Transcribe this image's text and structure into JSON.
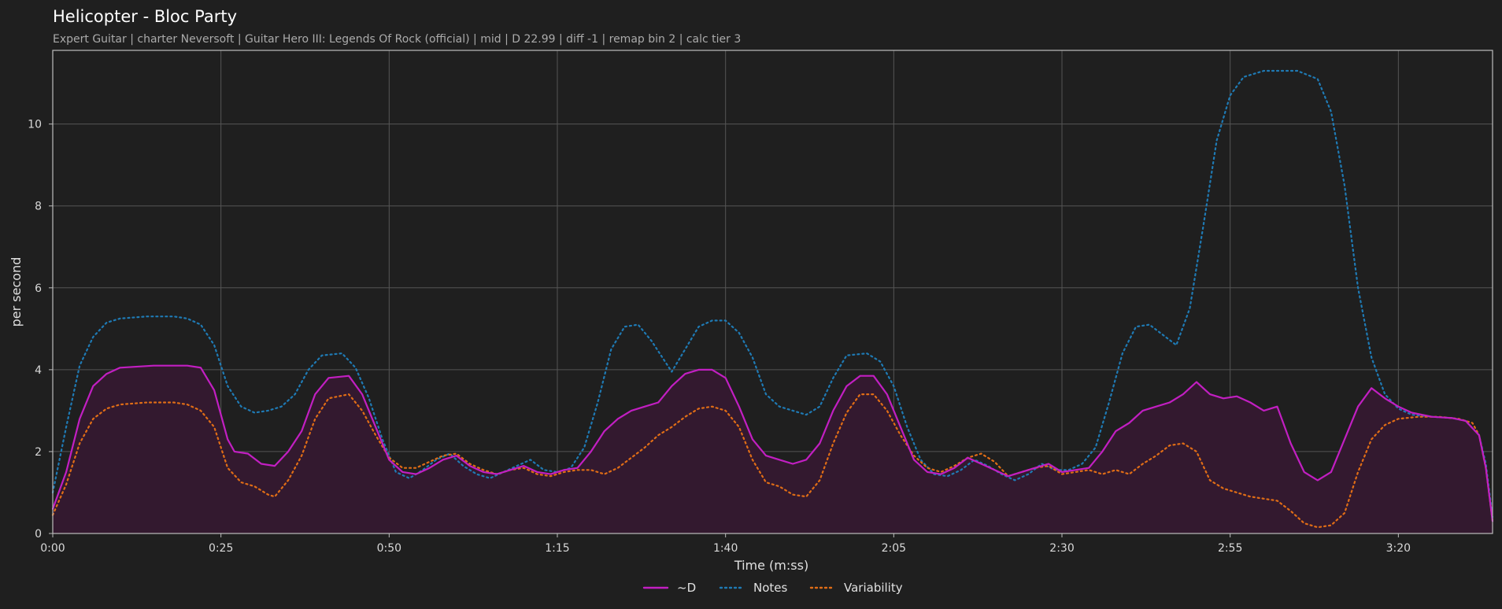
{
  "title": "Helicopter - Bloc Party",
  "subtitle": "Expert Guitar  |  charter Neversoft  |  Guitar Hero III: Legends Of Rock (official)  |  mid  |  D 22.99  |  diff -1  |  remap bin 2  |  calc tier 3",
  "chart_data": {
    "type": "line",
    "xlabel": "Time (m:ss)",
    "ylabel": "per second",
    "xlim": [
      0,
      214
    ],
    "ylim": [
      0,
      11.8
    ],
    "x_ticks": [
      0,
      25,
      50,
      75,
      100,
      125,
      150,
      175,
      200
    ],
    "x_tick_labels": [
      "0:00",
      "0:25",
      "0:50",
      "1:15",
      "1:40",
      "2:05",
      "2:30",
      "2:55",
      "3:20"
    ],
    "y_ticks": [
      0,
      2,
      4,
      6,
      8,
      10
    ],
    "y_tick_labels": [
      "0",
      "2",
      "4",
      "6",
      "8",
      "10"
    ],
    "grid": true,
    "legend_position": "bottom-center",
    "colors": {
      "d": "#c21fc2",
      "notes": "#1f7ab4",
      "variability": "#e06d16",
      "fill": "#33192f",
      "background": "#1f1f1f"
    },
    "series": [
      {
        "name": "~D",
        "style": "solid",
        "points": [
          [
            0,
            0.6
          ],
          [
            2,
            1.5
          ],
          [
            4,
            2.8
          ],
          [
            6,
            3.6
          ],
          [
            8,
            3.9
          ],
          [
            10,
            4.05
          ],
          [
            15,
            4.1
          ],
          [
            20,
            4.1
          ],
          [
            22,
            4.05
          ],
          [
            24,
            3.5
          ],
          [
            26,
            2.3
          ],
          [
            27,
            2.0
          ],
          [
            29,
            1.95
          ],
          [
            31,
            1.7
          ],
          [
            33,
            1.65
          ],
          [
            35,
            2.0
          ],
          [
            37,
            2.5
          ],
          [
            39,
            3.4
          ],
          [
            41,
            3.8
          ],
          [
            44,
            3.85
          ],
          [
            46,
            3.4
          ],
          [
            48,
            2.6
          ],
          [
            50,
            1.8
          ],
          [
            52,
            1.5
          ],
          [
            54,
            1.45
          ],
          [
            56,
            1.6
          ],
          [
            58,
            1.8
          ],
          [
            60,
            1.9
          ],
          [
            62,
            1.65
          ],
          [
            64,
            1.5
          ],
          [
            66,
            1.45
          ],
          [
            68,
            1.55
          ],
          [
            70,
            1.65
          ],
          [
            72,
            1.5
          ],
          [
            74,
            1.45
          ],
          [
            76,
            1.55
          ],
          [
            78,
            1.6
          ],
          [
            80,
            2.0
          ],
          [
            82,
            2.5
          ],
          [
            84,
            2.8
          ],
          [
            86,
            3.0
          ],
          [
            88,
            3.1
          ],
          [
            90,
            3.2
          ],
          [
            92,
            3.6
          ],
          [
            94,
            3.9
          ],
          [
            96,
            4.0
          ],
          [
            98,
            4.0
          ],
          [
            100,
            3.8
          ],
          [
            102,
            3.1
          ],
          [
            104,
            2.3
          ],
          [
            106,
            1.9
          ],
          [
            108,
            1.8
          ],
          [
            110,
            1.7
          ],
          [
            112,
            1.8
          ],
          [
            114,
            2.2
          ],
          [
            116,
            3.0
          ],
          [
            118,
            3.6
          ],
          [
            120,
            3.85
          ],
          [
            122,
            3.85
          ],
          [
            124,
            3.4
          ],
          [
            126,
            2.6
          ],
          [
            128,
            1.8
          ],
          [
            130,
            1.5
          ],
          [
            132,
            1.45
          ],
          [
            134,
            1.6
          ],
          [
            136,
            1.85
          ],
          [
            138,
            1.7
          ],
          [
            140,
            1.55
          ],
          [
            142,
            1.4
          ],
          [
            144,
            1.5
          ],
          [
            146,
            1.6
          ],
          [
            148,
            1.7
          ],
          [
            150,
            1.5
          ],
          [
            152,
            1.55
          ],
          [
            154,
            1.6
          ],
          [
            156,
            2.0
          ],
          [
            158,
            2.5
          ],
          [
            160,
            2.7
          ],
          [
            162,
            3.0
          ],
          [
            164,
            3.1
          ],
          [
            166,
            3.2
          ],
          [
            168,
            3.4
          ],
          [
            170,
            3.7
          ],
          [
            172,
            3.4
          ],
          [
            174,
            3.3
          ],
          [
            176,
            3.35
          ],
          [
            178,
            3.2
          ],
          [
            180,
            3.0
          ],
          [
            182,
            3.1
          ],
          [
            184,
            2.2
          ],
          [
            186,
            1.5
          ],
          [
            188,
            1.3
          ],
          [
            190,
            1.5
          ],
          [
            192,
            2.3
          ],
          [
            194,
            3.1
          ],
          [
            196,
            3.55
          ],
          [
            198,
            3.3
          ],
          [
            200,
            3.1
          ],
          [
            202,
            2.95
          ],
          [
            205,
            2.85
          ],
          [
            208,
            2.82
          ],
          [
            210,
            2.75
          ],
          [
            212,
            2.4
          ],
          [
            213,
            1.6
          ],
          [
            214,
            0.3
          ]
        ]
      },
      {
        "name": "Notes",
        "style": "dotted",
        "points": [
          [
            0,
            1.0
          ],
          [
            2,
            2.6
          ],
          [
            4,
            4.1
          ],
          [
            6,
            4.8
          ],
          [
            8,
            5.15
          ],
          [
            10,
            5.25
          ],
          [
            14,
            5.3
          ],
          [
            18,
            5.3
          ],
          [
            20,
            5.25
          ],
          [
            22,
            5.1
          ],
          [
            24,
            4.6
          ],
          [
            26,
            3.6
          ],
          [
            28,
            3.1
          ],
          [
            30,
            2.95
          ],
          [
            32,
            3.0
          ],
          [
            34,
            3.1
          ],
          [
            36,
            3.4
          ],
          [
            38,
            4.0
          ],
          [
            40,
            4.35
          ],
          [
            43,
            4.4
          ],
          [
            45,
            4.05
          ],
          [
            47,
            3.3
          ],
          [
            49,
            2.3
          ],
          [
            51,
            1.5
          ],
          [
            53,
            1.35
          ],
          [
            55,
            1.55
          ],
          [
            57,
            1.8
          ],
          [
            59,
            1.95
          ],
          [
            61,
            1.65
          ],
          [
            63,
            1.45
          ],
          [
            65,
            1.35
          ],
          [
            67,
            1.5
          ],
          [
            69,
            1.65
          ],
          [
            71,
            1.8
          ],
          [
            73,
            1.55
          ],
          [
            75,
            1.5
          ],
          [
            77,
            1.6
          ],
          [
            79,
            2.1
          ],
          [
            81,
            3.2
          ],
          [
            83,
            4.5
          ],
          [
            85,
            5.05
          ],
          [
            87,
            5.1
          ],
          [
            89,
            4.7
          ],
          [
            91,
            4.2
          ],
          [
            92,
            3.95
          ],
          [
            94,
            4.5
          ],
          [
            96,
            5.05
          ],
          [
            98,
            5.2
          ],
          [
            100,
            5.2
          ],
          [
            102,
            4.9
          ],
          [
            104,
            4.3
          ],
          [
            106,
            3.4
          ],
          [
            108,
            3.1
          ],
          [
            110,
            3.0
          ],
          [
            112,
            2.9
          ],
          [
            114,
            3.1
          ],
          [
            116,
            3.8
          ],
          [
            118,
            4.35
          ],
          [
            121,
            4.4
          ],
          [
            123,
            4.2
          ],
          [
            125,
            3.6
          ],
          [
            127,
            2.6
          ],
          [
            129,
            1.8
          ],
          [
            131,
            1.45
          ],
          [
            133,
            1.4
          ],
          [
            135,
            1.55
          ],
          [
            137,
            1.8
          ],
          [
            139,
            1.65
          ],
          [
            141,
            1.45
          ],
          [
            143,
            1.3
          ],
          [
            145,
            1.45
          ],
          [
            147,
            1.7
          ],
          [
            149,
            1.55
          ],
          [
            151,
            1.55
          ],
          [
            153,
            1.7
          ],
          [
            155,
            2.1
          ],
          [
            157,
            3.2
          ],
          [
            159,
            4.4
          ],
          [
            161,
            5.05
          ],
          [
            163,
            5.1
          ],
          [
            165,
            4.85
          ],
          [
            167,
            4.6
          ],
          [
            169,
            5.5
          ],
          [
            171,
            7.5
          ],
          [
            173,
            9.6
          ],
          [
            175,
            10.7
          ],
          [
            177,
            11.15
          ],
          [
            180,
            11.3
          ],
          [
            185,
            11.3
          ],
          [
            188,
            11.1
          ],
          [
            190,
            10.3
          ],
          [
            192,
            8.5
          ],
          [
            194,
            6.0
          ],
          [
            196,
            4.3
          ],
          [
            198,
            3.4
          ],
          [
            200,
            3.05
          ],
          [
            202,
            2.9
          ],
          [
            205,
            2.85
          ],
          [
            208,
            2.82
          ],
          [
            210,
            2.75
          ],
          [
            212,
            2.4
          ],
          [
            213,
            1.7
          ],
          [
            214,
            0.4
          ]
        ]
      },
      {
        "name": "Variability",
        "style": "dotted",
        "points": [
          [
            0,
            0.45
          ],
          [
            2,
            1.2
          ],
          [
            4,
            2.2
          ],
          [
            6,
            2.8
          ],
          [
            8,
            3.05
          ],
          [
            10,
            3.15
          ],
          [
            14,
            3.2
          ],
          [
            18,
            3.2
          ],
          [
            20,
            3.15
          ],
          [
            22,
            3.0
          ],
          [
            24,
            2.6
          ],
          [
            26,
            1.6
          ],
          [
            28,
            1.25
          ],
          [
            30,
            1.15
          ],
          [
            32,
            0.95
          ],
          [
            33,
            0.9
          ],
          [
            35,
            1.3
          ],
          [
            37,
            1.9
          ],
          [
            39,
            2.8
          ],
          [
            41,
            3.3
          ],
          [
            44,
            3.4
          ],
          [
            46,
            3.0
          ],
          [
            48,
            2.4
          ],
          [
            50,
            1.85
          ],
          [
            52,
            1.6
          ],
          [
            54,
            1.6
          ],
          [
            56,
            1.75
          ],
          [
            58,
            1.9
          ],
          [
            60,
            1.95
          ],
          [
            62,
            1.7
          ],
          [
            64,
            1.55
          ],
          [
            66,
            1.45
          ],
          [
            68,
            1.55
          ],
          [
            70,
            1.6
          ],
          [
            72,
            1.45
          ],
          [
            74,
            1.4
          ],
          [
            76,
            1.5
          ],
          [
            78,
            1.55
          ],
          [
            80,
            1.55
          ],
          [
            82,
            1.45
          ],
          [
            84,
            1.6
          ],
          [
            86,
            1.85
          ],
          [
            88,
            2.1
          ],
          [
            90,
            2.4
          ],
          [
            92,
            2.6
          ],
          [
            94,
            2.85
          ],
          [
            96,
            3.05
          ],
          [
            98,
            3.1
          ],
          [
            100,
            3.0
          ],
          [
            102,
            2.6
          ],
          [
            104,
            1.8
          ],
          [
            106,
            1.25
          ],
          [
            108,
            1.15
          ],
          [
            110,
            0.95
          ],
          [
            112,
            0.9
          ],
          [
            114,
            1.3
          ],
          [
            116,
            2.2
          ],
          [
            118,
            2.95
          ],
          [
            120,
            3.4
          ],
          [
            122,
            3.4
          ],
          [
            124,
            3.0
          ],
          [
            126,
            2.4
          ],
          [
            128,
            1.9
          ],
          [
            130,
            1.6
          ],
          [
            132,
            1.5
          ],
          [
            134,
            1.65
          ],
          [
            136,
            1.85
          ],
          [
            138,
            1.95
          ],
          [
            140,
            1.75
          ],
          [
            142,
            1.4
          ],
          [
            144,
            1.5
          ],
          [
            146,
            1.6
          ],
          [
            148,
            1.65
          ],
          [
            150,
            1.45
          ],
          [
            152,
            1.5
          ],
          [
            154,
            1.55
          ],
          [
            156,
            1.45
          ],
          [
            158,
            1.55
          ],
          [
            160,
            1.45
          ],
          [
            162,
            1.7
          ],
          [
            164,
            1.9
          ],
          [
            166,
            2.15
          ],
          [
            168,
            2.2
          ],
          [
            170,
            2.0
          ],
          [
            172,
            1.3
          ],
          [
            174,
            1.1
          ],
          [
            176,
            1.0
          ],
          [
            178,
            0.9
          ],
          [
            180,
            0.85
          ],
          [
            182,
            0.8
          ],
          [
            184,
            0.55
          ],
          [
            186,
            0.25
          ],
          [
            188,
            0.15
          ],
          [
            190,
            0.2
          ],
          [
            192,
            0.5
          ],
          [
            194,
            1.5
          ],
          [
            196,
            2.3
          ],
          [
            198,
            2.65
          ],
          [
            200,
            2.8
          ],
          [
            203,
            2.85
          ],
          [
            206,
            2.85
          ],
          [
            209,
            2.8
          ],
          [
            211,
            2.7
          ],
          [
            212,
            2.4
          ],
          [
            213,
            1.6
          ],
          [
            214,
            0.3
          ]
        ]
      }
    ]
  },
  "legend": {
    "items": [
      {
        "label": "~D",
        "series": 0
      },
      {
        "label": "Notes",
        "series": 1
      },
      {
        "label": "Variability",
        "series": 2
      }
    ]
  }
}
